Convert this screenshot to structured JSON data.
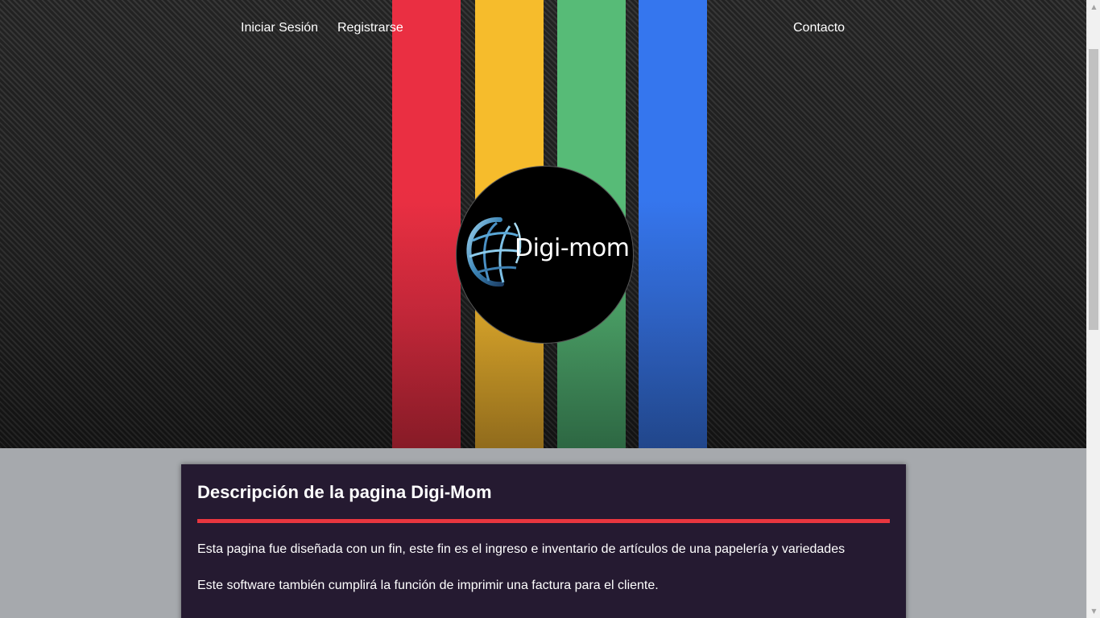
{
  "nav": {
    "login_label": "Iniciar Sesión",
    "register_label": "Registrarse",
    "contact_label": "Contacto"
  },
  "logo": {
    "text": "Digi-mom"
  },
  "colors": {
    "stripe_red": "#ea2f42",
    "stripe_yellow": "#f6bc2c",
    "stripe_green": "#57bb77",
    "stripe_blue": "#3576ee",
    "card_background": "#251a31",
    "divider": "#e8363f",
    "page_background": "#a6a9ad"
  },
  "description": {
    "title": "Descripción de la pagina Digi-Mom",
    "paragraph_1": "Esta pagina fue diseñada con un fin, este fin es el ingreso e inventario de artículos de una papelería y variedades",
    "paragraph_2": "Este software también cumplirá la función de imprimir una factura para el cliente."
  },
  "scrollbar": {
    "up_icon": "arrow-up",
    "down_icon": "arrow-down"
  }
}
